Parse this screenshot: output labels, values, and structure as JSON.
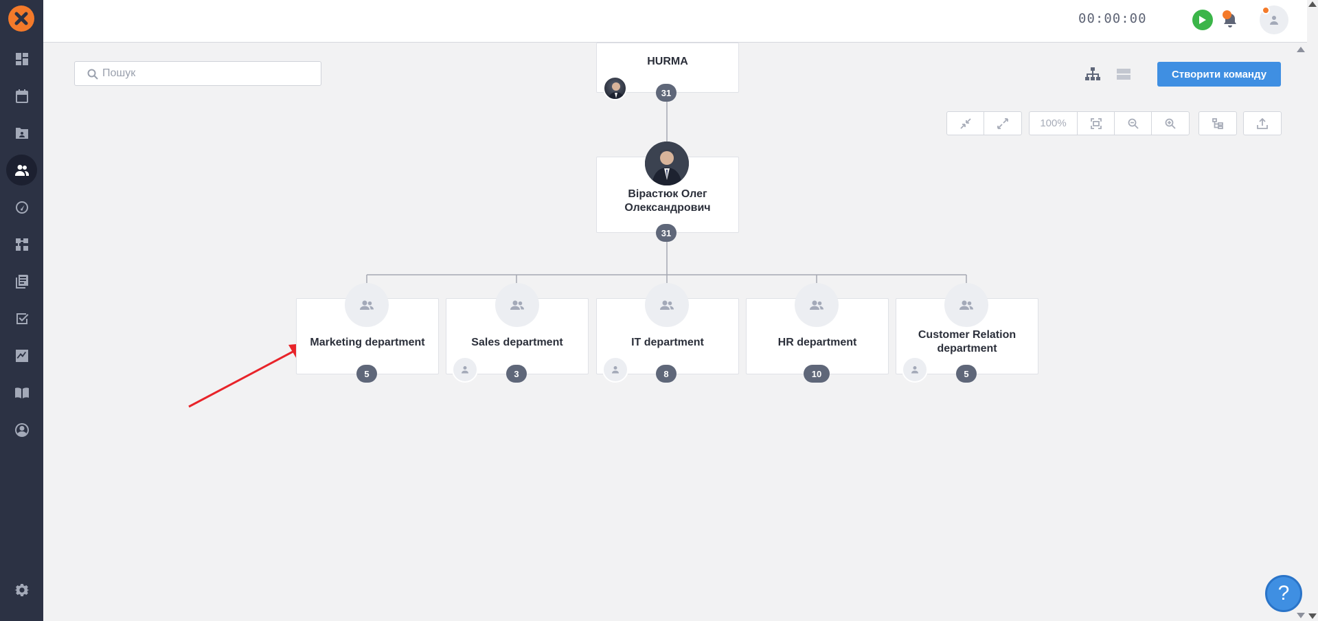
{
  "topbar": {
    "timer": "00:00:00"
  },
  "search": {
    "placeholder": "Пошук",
    "value": ""
  },
  "actions": {
    "create_team": "Створити команду"
  },
  "toolbar": {
    "zoom_level": "100%"
  },
  "orgchart": {
    "root": {
      "name": "HURMA",
      "count": "31"
    },
    "head": {
      "name_line1": "Вірастюк Олег",
      "name_line2": "Олександрович",
      "count": "31"
    },
    "departments": [
      {
        "name": "Marketing department",
        "count": "5"
      },
      {
        "name": "Sales department",
        "count": "3"
      },
      {
        "name": "IT department",
        "count": "8"
      },
      {
        "name": "HR department",
        "count": "10"
      },
      {
        "name_line1": "Customer Relation",
        "name_line2": "department",
        "count": "5"
      }
    ]
  },
  "help": {
    "label": "?"
  },
  "colors": {
    "sidebar": "#2c3244",
    "accent": "#3f8fe2",
    "brand": "#f47a2a",
    "badge": "#5f6779",
    "play": "#3bb549",
    "annotation": "#e8242a"
  }
}
